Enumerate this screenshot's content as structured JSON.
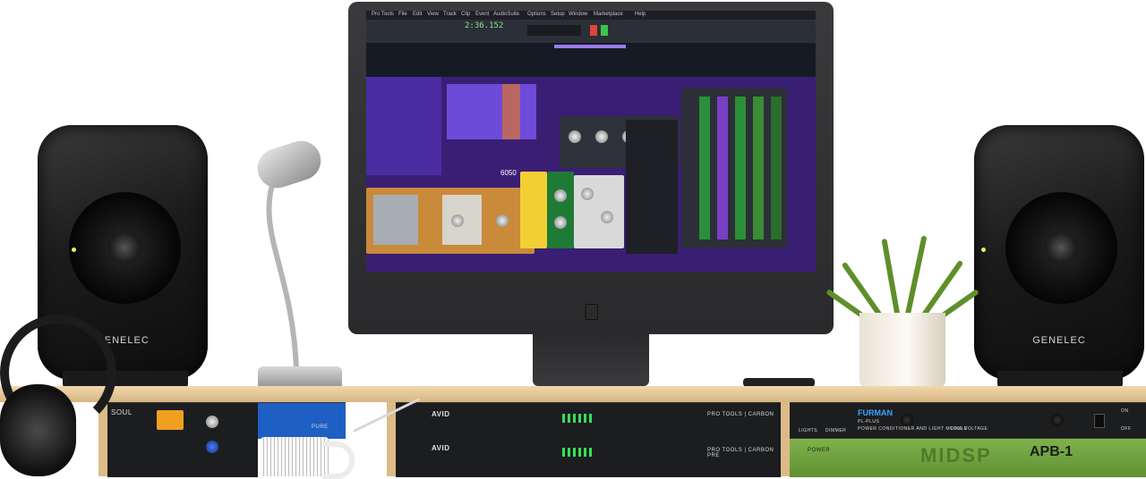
{
  "speaker_brand": "GENELEC",
  "daw": {
    "menu_items": [
      "Pro Tools",
      "File",
      "Edit",
      "View",
      "Track",
      "Clip",
      "Event",
      "AudioSuite",
      "Options",
      "Setup",
      "Window",
      "Marketplace",
      "Help"
    ],
    "counter": "2:36.152",
    "meter_value": "6050"
  },
  "rack": {
    "avid_label": "AVID",
    "carbon_label": "PRO TOOLS | CARBON",
    "carbon_pre_label": "PRO TOOLS | CARBON PRE",
    "furman_brand": "FURMAN",
    "furman_model": "PL-PLUS",
    "furman_desc": "POWER CONDITIONER AND LIGHT MODULE",
    "line_voltage": "LINE VOLTAGE",
    "lights_label": "LIGHTS",
    "dimmer_label": "DIMMER",
    "on_label": "ON",
    "off_label": "OFF",
    "power_label": "POWER",
    "apb_model": "APB-1",
    "midsp_logo": "MIDSP",
    "pure_label": "PURE",
    "soul_label": "SOUL"
  },
  "colors": {
    "daw_purple": "#3a1e74",
    "daw_panel": "#2c2f37",
    "desk_wood": "#e4c591",
    "furman_blue": "#3aa2ff",
    "meter_green": "#36e05a"
  }
}
